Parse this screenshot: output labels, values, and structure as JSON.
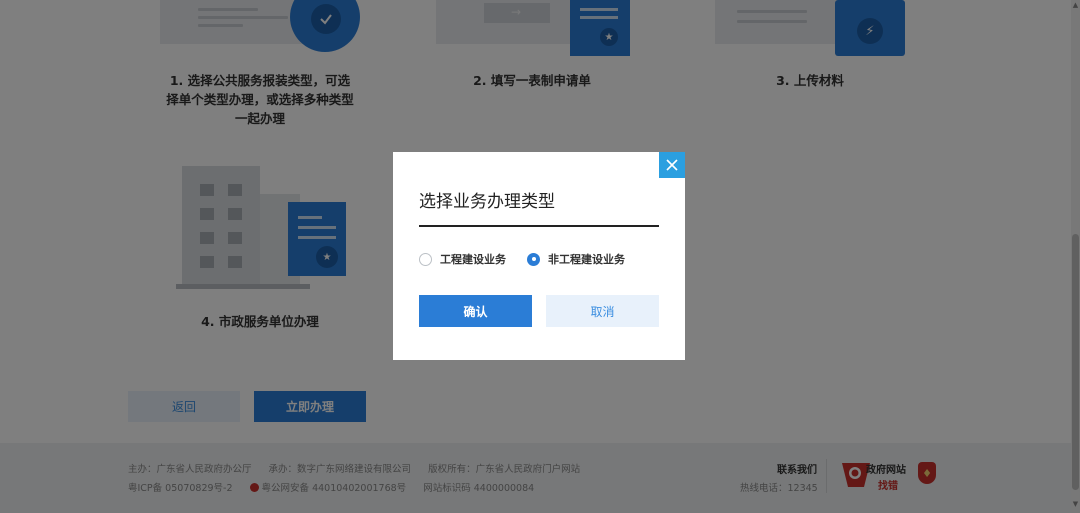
{
  "steps": [
    {
      "label_line1": "1. 选择公共服务报装类型，可选",
      "label_line2": "择单个类型办理，或选择多种类型",
      "label_line3": "一起办理"
    },
    {
      "label": "2. 填写一表制申请单"
    },
    {
      "label": "3. 上传材料"
    },
    {
      "label": "4. 市政服务单位办理"
    }
  ],
  "actions": {
    "back_label": "返回",
    "apply_label": "立即办理"
  },
  "footer": {
    "host": "主办：广东省人民政府办公厅",
    "operator": "承办：数字广东网络建设有限公司",
    "copyright": "版权所有：广东省人民政府门户网站",
    "icp": "粤ICP备 05070829号-2",
    "police": "粤公网安备 44010402001768号",
    "site_code": "网站标识码 4400000084",
    "contact_label": "联系我们",
    "hotline": "热线电话：12345",
    "gov_site_label": "政府网站",
    "gov_find_error": "找错"
  },
  "modal": {
    "title": "选择业务办理类型",
    "options": [
      {
        "label": "工程建设业务",
        "checked": false
      },
      {
        "label": "非工程建设业务",
        "checked": true
      }
    ],
    "confirm_label": "确认",
    "cancel_label": "取消"
  },
  "colors": {
    "accent": "#2b7dd6",
    "close_button": "#2b9fe0",
    "secondary_button_bg": "#e8f1fb"
  }
}
